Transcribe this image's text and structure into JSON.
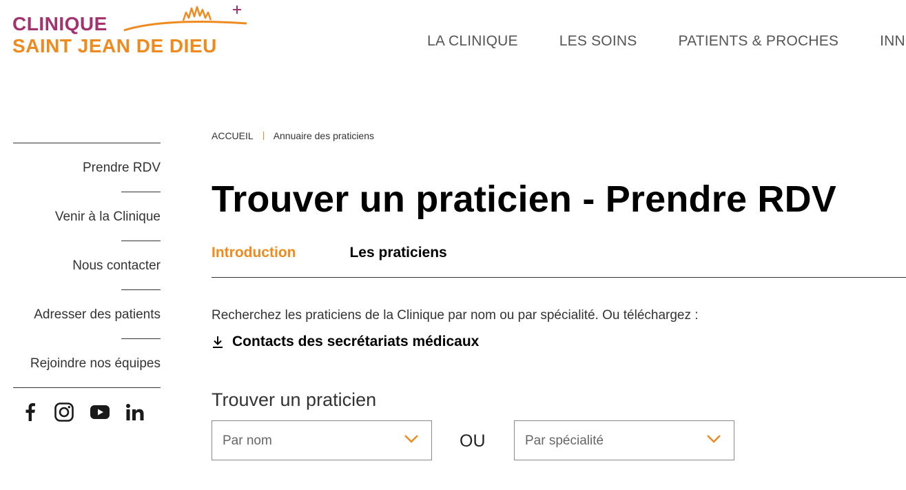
{
  "brand": {
    "line1": "CLINIQUE",
    "line2": "SAINT JEAN DE DIEU",
    "color_primary": "#a3336e",
    "color_accent": "#ef8a1f"
  },
  "nav": {
    "items": [
      {
        "label": "LA CLINIQUE"
      },
      {
        "label": "LES SOINS"
      },
      {
        "label": "PATIENTS & PROCHES"
      },
      {
        "label": "INNOVA"
      }
    ]
  },
  "sidebar": {
    "items": [
      {
        "label": "Prendre RDV"
      },
      {
        "label": "Venir à la Clinique"
      },
      {
        "label": "Nous contacter"
      },
      {
        "label": "Adresser des patients"
      },
      {
        "label": "Rejoindre nos équipes"
      }
    ],
    "socials": [
      "facebook-icon",
      "instagram-icon",
      "youtube-icon",
      "linkedin-icon"
    ]
  },
  "breadcrumb": {
    "home": "ACCUEIL",
    "current": "Annuaire des praticiens"
  },
  "page": {
    "title": "Trouver un praticien - Prendre RDV",
    "tabs": [
      {
        "label": "Introduction",
        "active": true
      },
      {
        "label": "Les praticiens",
        "active": false
      }
    ],
    "intro": "Recherchez les praticiens de la Clinique par nom ou par spécialité. Ou téléchargez :",
    "download_label": "Contacts des secrétariats médicaux"
  },
  "finder": {
    "title": "Trouver un praticien",
    "name_placeholder": "Par nom",
    "or_label": "OU",
    "specialty_placeholder": "Par spécialité"
  }
}
